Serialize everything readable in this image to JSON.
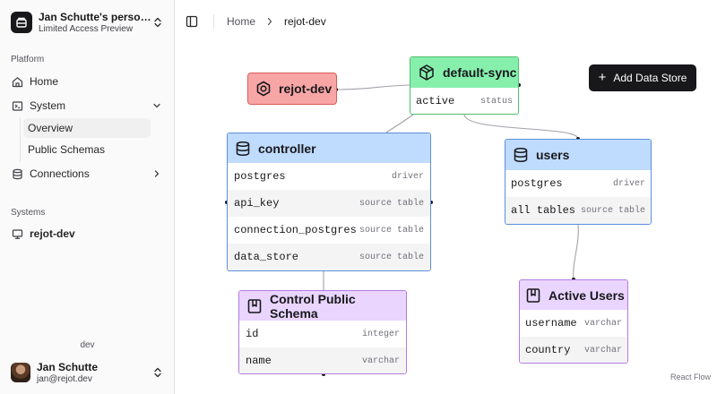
{
  "workspace": {
    "name": "Jan Schutte's personal workspace",
    "subtitle": "Limited Access Preview"
  },
  "sidebar": {
    "platform_label": "Platform",
    "items": [
      {
        "label": "Home",
        "icon": "home-icon"
      },
      {
        "label": "System",
        "icon": "system-icon",
        "expanded": true
      },
      {
        "label": "Connections",
        "icon": "database-icon",
        "expanded": false
      }
    ],
    "system_children": [
      {
        "label": "Overview",
        "active": true
      },
      {
        "label": "Public Schemas",
        "active": false
      }
    ],
    "systems_label": "Systems",
    "systems": [
      {
        "label": "rejot-dev",
        "icon": "monitor-icon"
      }
    ],
    "environment": "dev",
    "user": {
      "name": "Jan Schutte",
      "email": "jan@rejot.dev"
    }
  },
  "header": {
    "breadcrumb": [
      "Home",
      "rejot-dev"
    ]
  },
  "canvas": {
    "add_button_label": "Add Data Store",
    "attribution": "React Flow",
    "colors": {
      "system": "#f8a5a5",
      "sync": "#86efac",
      "datastore": "#bfdbfe",
      "schema": "#e9d5ff"
    },
    "nodes": {
      "rejot": {
        "title": "rejot-dev"
      },
      "sync": {
        "title": "default-sync",
        "rows": [
          {
            "key": "active",
            "value": "status"
          }
        ]
      },
      "controller": {
        "title": "controller",
        "rows": [
          {
            "key": "postgres",
            "value": "driver"
          },
          {
            "key": "api_key",
            "value": "source table"
          },
          {
            "key": "connection_postgres",
            "value": "source table"
          },
          {
            "key": "data_store",
            "value": "source table"
          }
        ]
      },
      "users": {
        "title": "users",
        "rows": [
          {
            "key": "postgres",
            "value": "driver"
          },
          {
            "key": "all tables",
            "value": "source table"
          }
        ]
      },
      "control_public_schema": {
        "title": "Control Public Schema",
        "rows": [
          {
            "key": "id",
            "value": "integer"
          },
          {
            "key": "name",
            "value": "varchar"
          }
        ]
      },
      "active_users": {
        "title": "Active Users",
        "rows": [
          {
            "key": "username",
            "value": "varchar"
          },
          {
            "key": "country",
            "value": "varchar"
          }
        ]
      }
    }
  }
}
